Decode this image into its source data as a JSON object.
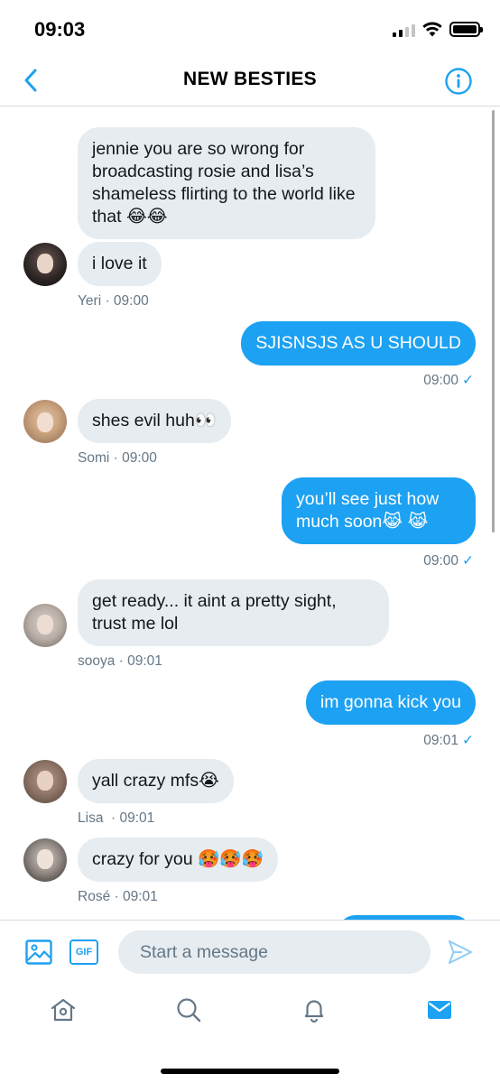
{
  "status_bar": {
    "time": "09:03"
  },
  "header": {
    "title": "NEW BESTIES"
  },
  "colors": {
    "accent": "#1da1f2",
    "incoming_bubble": "#e6ecf0",
    "meta_text": "#657786"
  },
  "messages": [
    {
      "direction": "in",
      "text": "jennie you are so wrong for broadcasting rosie and lisa’s shameless flirting to the world like that 😂😂"
    },
    {
      "direction": "in",
      "text": "i love it",
      "meta": "Yeri · 09:00"
    },
    {
      "direction": "out",
      "text": "SJISNSJS AS U SHOULD",
      "meta": "09:00"
    },
    {
      "direction": "in",
      "text": "shes evil huh👀",
      "meta": "Somi · 09:00"
    },
    {
      "direction": "out",
      "text": "you’ll see just how much soon😹 😹",
      "meta": "09:00"
    },
    {
      "direction": "in",
      "text": "get ready... it aint a pretty sight, trust me lol",
      "meta": "sooya · 09:01"
    },
    {
      "direction": "out",
      "text": "im gonna kick you",
      "meta": "09:01"
    },
    {
      "direction": "in",
      "text": "yall crazy mfs😭",
      "meta": "Lisa  · 09:01"
    },
    {
      "direction": "in",
      "text": "crazy for you 🥵🥵🥵",
      "meta": "Rosé · 09:01"
    }
  ],
  "composer": {
    "placeholder": "Start a message",
    "gif_label": "GIF"
  },
  "icons": {
    "back": "chevron-left-icon",
    "info": "info-icon",
    "image": "image-icon",
    "gif": "gif-icon",
    "send": "send-icon",
    "tabs": [
      "home-icon",
      "search-icon",
      "bell-icon",
      "mail-icon"
    ]
  }
}
